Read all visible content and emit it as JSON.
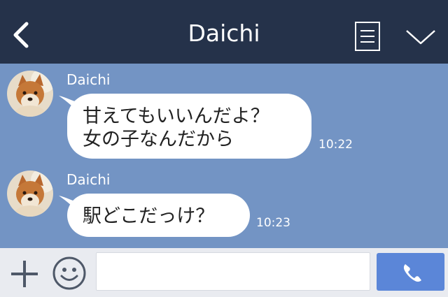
{
  "header": {
    "title": "Daichi",
    "back_icon": "chevron-left-icon",
    "notes_icon": "notes-icon",
    "menu_icon": "chevron-down-icon"
  },
  "messages": [
    {
      "sender": "Daichi",
      "text": "甘えてもいいんだよ？\n女の子なんだから",
      "time": "10:22"
    },
    {
      "sender": "Daichi",
      "text": "駅どこだっけ？",
      "time": "10:23"
    }
  ],
  "footer": {
    "plus_icon": "plus-icon",
    "emoji_icon": "smiley-icon",
    "input_value": "",
    "input_placeholder": "",
    "call_icon": "phone-icon"
  },
  "colors": {
    "header_bg": "#25324a",
    "chat_bg": "#7394c4",
    "footer_bg": "#e9ebf0",
    "call_button": "#5b86d8"
  }
}
